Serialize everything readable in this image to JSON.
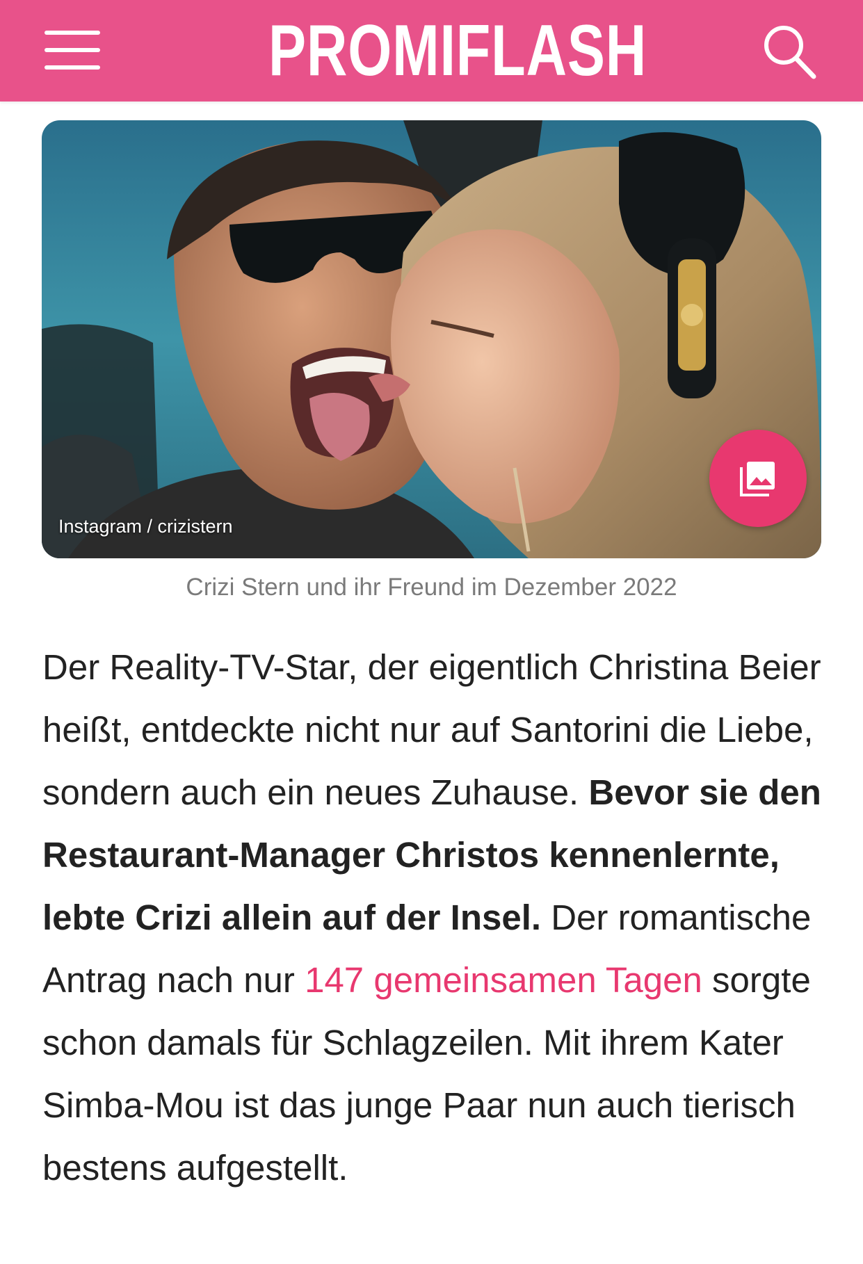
{
  "header": {
    "brand": "PROMIFLASH",
    "menu_icon": "hamburger-menu-icon",
    "search_icon": "search-icon",
    "background_color": "#e8528a"
  },
  "photo": {
    "credit": "Instagram / crizistern",
    "gallery_icon": "photo-gallery-icon",
    "gallery_button_color": "#e8386f"
  },
  "caption": "Crizi Stern und ihr Freund im Dezember 2022",
  "article": {
    "text_1": "Der Reality-TV-Star, der eigentlich Christina Beier heißt, entdeckte nicht nur auf Santorini die Liebe, sondern auch ein neues Zuhause. ",
    "bold_text": "Bevor sie den Restaurant-Manager Christos kennenlernte, lebte Crizi allein auf der Insel.",
    "text_2": " Der romantische Antrag nach nur ",
    "link_text": "147 gemeinsamen Tagen",
    "text_3": " sorgte schon damals für Schlagzeilen. Mit ihrem Kater Simba-Mou ist das junge Paar nun auch tierisch bestens aufgestellt.",
    "link_color": "#e8386f"
  }
}
